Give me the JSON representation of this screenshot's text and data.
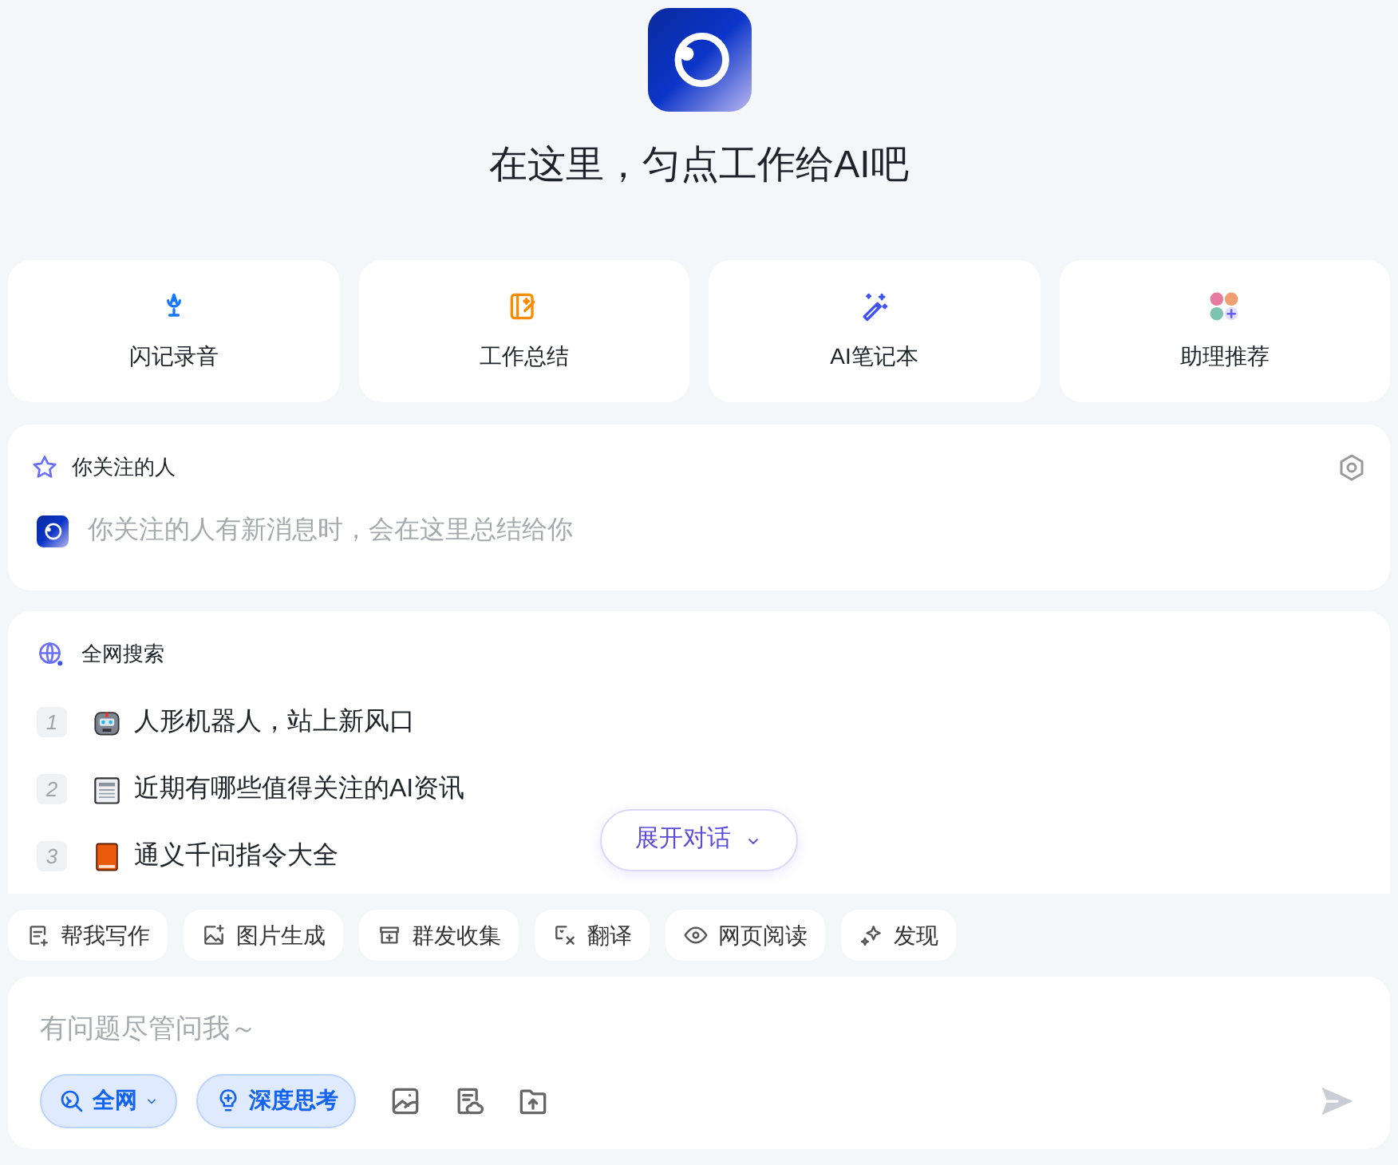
{
  "header": {
    "title": "在这里，匀点工作给AI吧"
  },
  "shortcuts": [
    {
      "kind": "mic",
      "label": "闪记录音"
    },
    {
      "kind": "note",
      "label": "工作总结"
    },
    {
      "kind": "wand",
      "label": "AI笔记本"
    },
    {
      "kind": "avatars",
      "label": "助理推荐"
    }
  ],
  "following": {
    "title": "你关注的人",
    "message": "你关注的人有新消息时，会在这里总结给你"
  },
  "web_search": {
    "title": "全网搜索",
    "items": [
      {
        "rank": "1",
        "kind": "robot",
        "text": "人形机器人，站上新风口"
      },
      {
        "rank": "2",
        "kind": "news",
        "text": "近期有哪些值得关注的AI资讯"
      },
      {
        "rank": "3",
        "kind": "book",
        "text": "通义千问指令大全"
      }
    ]
  },
  "expand_button": {
    "label": "展开对话"
  },
  "tools": [
    {
      "kind": "write",
      "label": "帮我写作"
    },
    {
      "kind": "image",
      "label": "图片生成"
    },
    {
      "kind": "box",
      "label": "群发收集"
    },
    {
      "kind": "translate",
      "label": "翻译"
    },
    {
      "kind": "eye",
      "label": "网页阅读"
    },
    {
      "kind": "sparkle",
      "label": "发现"
    }
  ],
  "composer": {
    "placeholder": "有问题尽管问我～",
    "modes": [
      {
        "kind": "web",
        "label": "全网",
        "selected": true
      },
      {
        "kind": "think",
        "label": "深度思考",
        "selected": true
      }
    ]
  }
}
